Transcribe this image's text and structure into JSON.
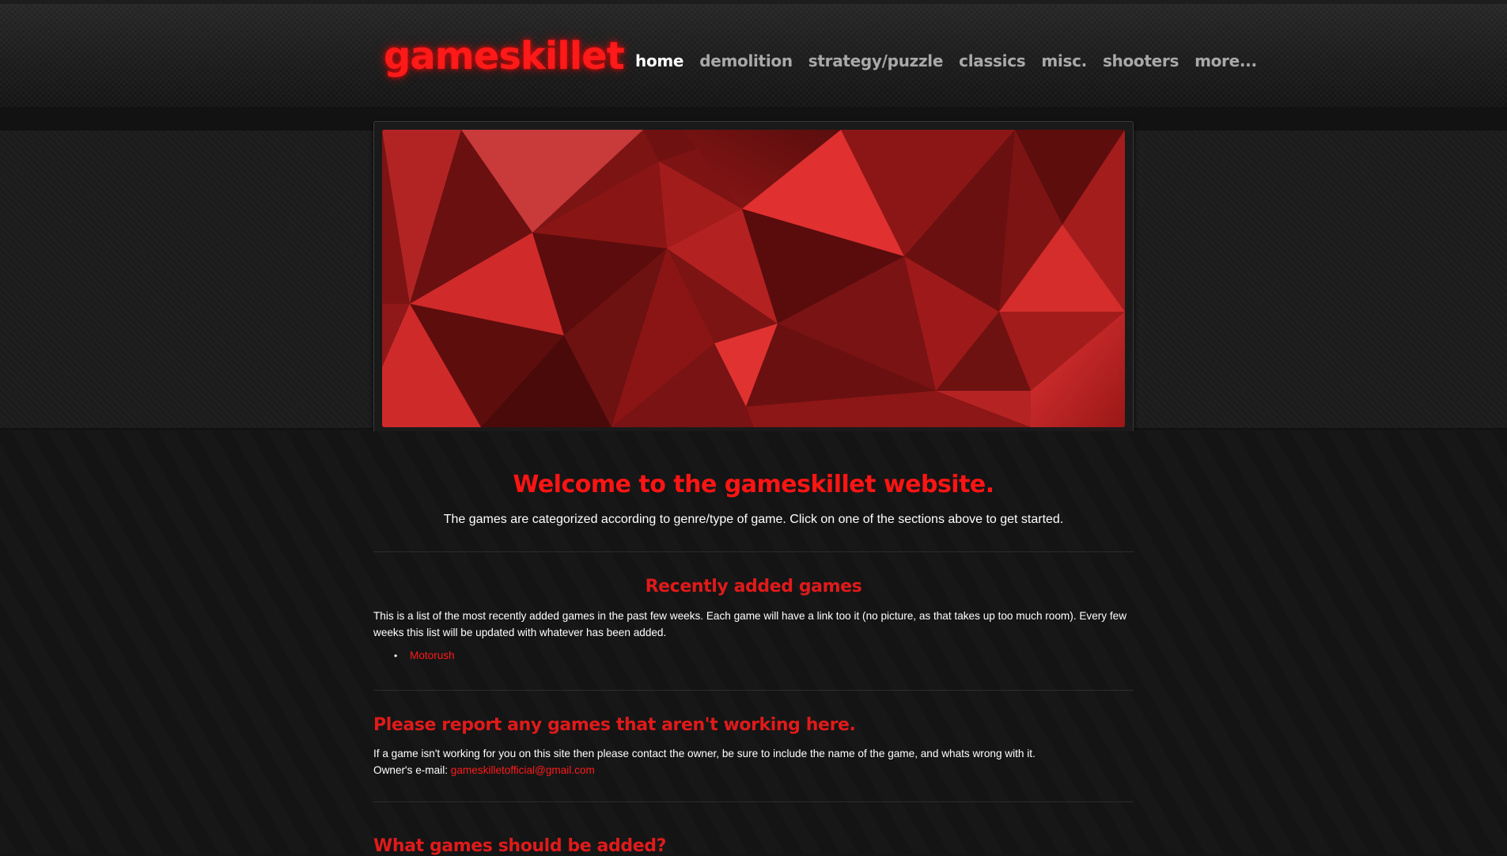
{
  "header": {
    "logo": "gameskillet",
    "nav": [
      {
        "label": "home",
        "active": true
      },
      {
        "label": "demolition",
        "active": false
      },
      {
        "label": "strategy/puzzle",
        "active": false
      },
      {
        "label": "classics",
        "active": false
      },
      {
        "label": "misc.",
        "active": false
      },
      {
        "label": "shooters",
        "active": false
      },
      {
        "label": "more...",
        "active": false
      }
    ]
  },
  "welcome": {
    "title": "Welcome to the gameskillet website.",
    "text": "The games are categorized according to genre/type of game. Click on one of the sections above to get started."
  },
  "recent": {
    "title": "Recently added games",
    "text": "This is a list of the most recently added games in the past few weeks. Each game will have a link too it (no picture, as that takes up too much room). Every few weeks this list will be updated with whatever has been added.",
    "games": [
      "Motorush"
    ]
  },
  "report": {
    "title": "Please report any games that aren't working here.",
    "text": "If a game isn't working for you on this site then please contact the owner, be sure to include the name of the game, and whats wrong with it.",
    "email_label": "Owner's e-mail:",
    "email": "gameskilletofficial@gmail.com"
  },
  "suggest": {
    "title": "What games should be added?"
  },
  "colors": {
    "accent": "#ff1a1a",
    "background": "#151515"
  }
}
